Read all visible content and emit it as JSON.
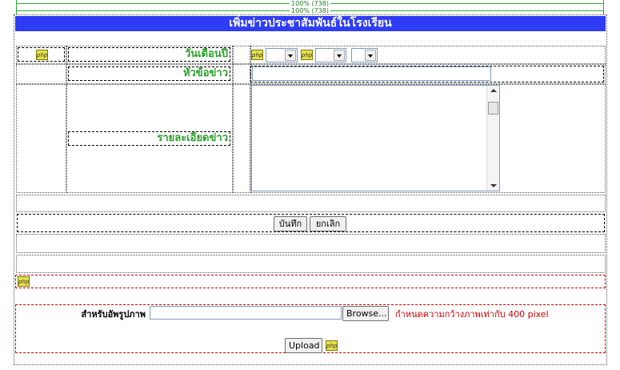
{
  "rulers": [
    "100% (738)",
    "100% (738)"
  ],
  "page_title": "เพิ่มข่าวประชาสัมพันธ์ในโรงเรียน",
  "form": {
    "date_label": "วันเดือนปี",
    "headline_label": "หัวข้อข่าว",
    "detail_label": "รายละเอียดข่าว",
    "headline_value": "",
    "detail_value": "",
    "save_label": "บันทึก",
    "cancel_label": "ยกเลิก"
  },
  "upload": {
    "label": "สำหรับอัพรูปภาพ",
    "file_value": "",
    "browse_label": "Browse...",
    "hint": "กำหนดความกว้างภาพเท่ากับ 400 pixel",
    "upload_label": "Upload"
  },
  "icons": {
    "php": "php"
  },
  "colors": {
    "title_bg": "#2f3cf5",
    "label_green": "#2aa02a",
    "hint_red": "#cc0000"
  }
}
